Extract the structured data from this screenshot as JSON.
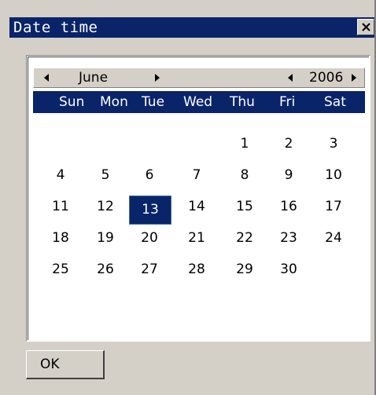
{
  "window": {
    "title": "Date time"
  },
  "nav": {
    "month": "June",
    "year": "2006"
  },
  "weekdays": [
    "Sun",
    "Mon",
    "Tue",
    "Wed",
    "Thu",
    "Fri",
    "Sat"
  ],
  "weeks": [
    [
      "",
      "",
      "",
      "",
      "1",
      "2",
      "3"
    ],
    [
      "4",
      "5",
      "6",
      "7",
      "8",
      "9",
      "10"
    ],
    [
      "11",
      "12",
      "13",
      "14",
      "15",
      "16",
      "17"
    ],
    [
      "18",
      "19",
      "20",
      "21",
      "22",
      "23",
      "24"
    ],
    [
      "25",
      "26",
      "27",
      "28",
      "29",
      "30",
      ""
    ]
  ],
  "selected_day": "13",
  "buttons": {
    "ok": "OK"
  },
  "icons": {
    "close": "close-icon",
    "prev": "left-arrow-icon",
    "next": "right-arrow-icon"
  },
  "colors": {
    "titlebar": "#0a246a",
    "face": "#d4d0c8",
    "selection": "#0a246a"
  }
}
